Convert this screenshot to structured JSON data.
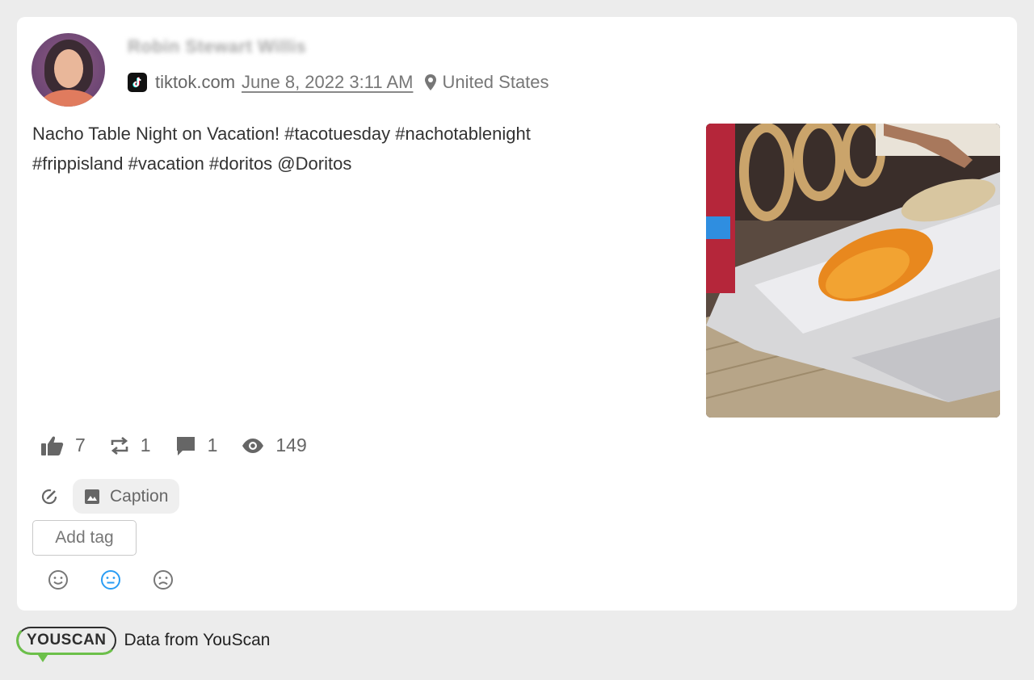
{
  "post": {
    "author": "Robin Stewart Willis",
    "source": "tiktok.com",
    "date": "June 8, 2022 3:11 AM",
    "location": "United States",
    "text_line1": "Nacho Table Night on Vacation! #tacotuesday #nachotablenight",
    "text_line2": "#frippisland #vacation #doritos @Doritos",
    "media_icon": "tiktok-icon"
  },
  "stats": {
    "likes": "7",
    "reposts": "1",
    "comments": "1",
    "views": "149"
  },
  "tools": {
    "caption_label": "Caption",
    "add_tag_label": "Add tag"
  },
  "sentiment": {
    "options": [
      "positive",
      "neutral",
      "negative"
    ],
    "selected": "neutral",
    "selected_color": "#2a9df4"
  },
  "footer": {
    "logo_text": "YOUSCAN",
    "text": "Data from YouScan"
  }
}
